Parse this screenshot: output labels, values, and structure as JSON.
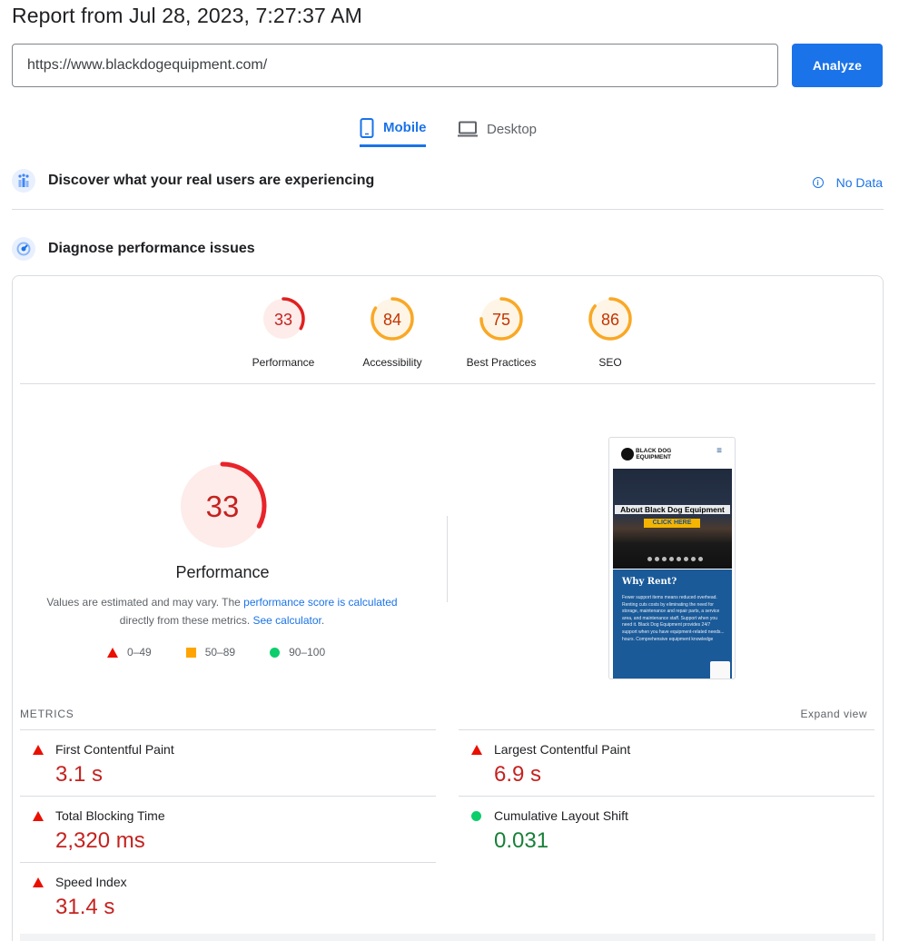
{
  "header": {
    "title": "Report from Jul 28, 2023, 7:27:37 AM"
  },
  "search": {
    "url": "https://www.blackdogequipment.com/",
    "analyze_label": "Analyze"
  },
  "tabs": [
    {
      "label": "Mobile",
      "active": true
    },
    {
      "label": "Desktop",
      "active": false
    }
  ],
  "real_users": {
    "title": "Discover what your real users are experiencing",
    "status": "No Data"
  },
  "diagnose": {
    "title": "Diagnose performance issues"
  },
  "scores": [
    {
      "label": "Performance",
      "value": "33",
      "fraction": 0.33,
      "color": "#e02020",
      "bg": "#fdecea",
      "text_color": "#c5221f"
    },
    {
      "label": "Accessibility",
      "value": "84",
      "fraction": 0.84,
      "color": "#f9a825",
      "bg": "#fff5e6",
      "text_color": "#c33300"
    },
    {
      "label": "Best Practices",
      "value": "75",
      "fraction": 0.75,
      "color": "#f9a825",
      "bg": "#fff5e6",
      "text_color": "#c33300"
    },
    {
      "label": "SEO",
      "value": "86",
      "fraction": 0.86,
      "color": "#f9a825",
      "bg": "#fff5e6",
      "text_color": "#c33300"
    }
  ],
  "performance": {
    "score": "33",
    "fraction": 0.33,
    "title": "Performance",
    "desc_1": "Values are estimated and may vary. The ",
    "desc_link_1": "performance score is calculated",
    "desc_2": " directly from these metrics. ",
    "desc_link_2": "See calculator",
    "desc_3": "."
  },
  "legend": {
    "poor": "0–49",
    "average": "50–89",
    "good": "90–100"
  },
  "screenshot": {
    "logo_line1": "BLACK DOG",
    "logo_line2": "EQUIPMENT",
    "menu_icon": "≡",
    "hero_title": "About Black Dog Equipment",
    "hero_button": "CLICK HERE",
    "section_title": "Why Rent?",
    "section_text": "Fewer support items means reduced overhead. Renting cuts costs by eliminating the need for storage, maintenance and repair parts, a service area, and maintenance staff. Support when you need it. Black Dog Equipment provides 24/7 support when you have equipment-related needs... hours. Comprehensive equipment knowledge"
  },
  "metrics": {
    "label": "METRICS",
    "expand": "Expand view",
    "items": [
      {
        "name": "First Contentful Paint",
        "value": "3.1 s",
        "status": "poor"
      },
      {
        "name": "Largest Contentful Paint",
        "value": "6.9 s",
        "status": "poor"
      },
      {
        "name": "Total Blocking Time",
        "value": "2,320 ms",
        "status": "poor"
      },
      {
        "name": "Cumulative Layout Shift",
        "value": "0.031",
        "status": "good"
      },
      {
        "name": "Speed Index",
        "value": "31.4 s",
        "status": "poor"
      }
    ]
  }
}
